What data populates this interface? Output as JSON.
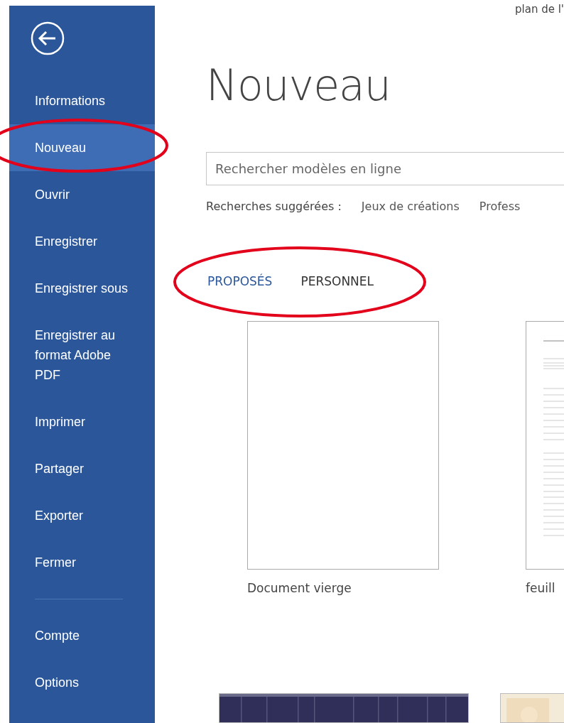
{
  "sidebar": {
    "items": [
      {
        "label": "Informations",
        "selected": false
      },
      {
        "label": "Nouveau",
        "selected": true
      },
      {
        "label": "Ouvrir",
        "selected": false
      },
      {
        "label": "Enregistrer",
        "selected": false
      },
      {
        "label": "Enregistrer sous",
        "selected": false
      },
      {
        "label": "Enregistrer au format Adobe PDF",
        "selected": false
      },
      {
        "label": "Imprimer",
        "selected": false
      },
      {
        "label": "Partager",
        "selected": false
      },
      {
        "label": "Exporter",
        "selected": false
      },
      {
        "label": "Fermer",
        "selected": false
      }
    ],
    "footer_items": [
      {
        "label": "Compte",
        "selected": false
      },
      {
        "label": "Options",
        "selected": false
      }
    ]
  },
  "top_right_text": "plan de l'",
  "title": "Nouveau",
  "search": {
    "placeholder": "Rechercher modèles en ligne"
  },
  "suggested": {
    "label": "Recherches suggérées :",
    "items": [
      "Jeux de créations",
      "Profess"
    ]
  },
  "tabs": [
    {
      "label": "PROPOSÉS",
      "selected": true
    },
    {
      "label": "PERSONNEL",
      "selected": false
    }
  ],
  "templates": [
    {
      "kind": "blank",
      "label": "Document vierge"
    },
    {
      "kind": "lined",
      "label": "feuill"
    }
  ],
  "more_templates": [
    {
      "kind": "dark"
    },
    {
      "kind": "light"
    }
  ],
  "annotations": [
    {
      "kind": "ellipse"
    },
    {
      "kind": "ellipse"
    }
  ]
}
